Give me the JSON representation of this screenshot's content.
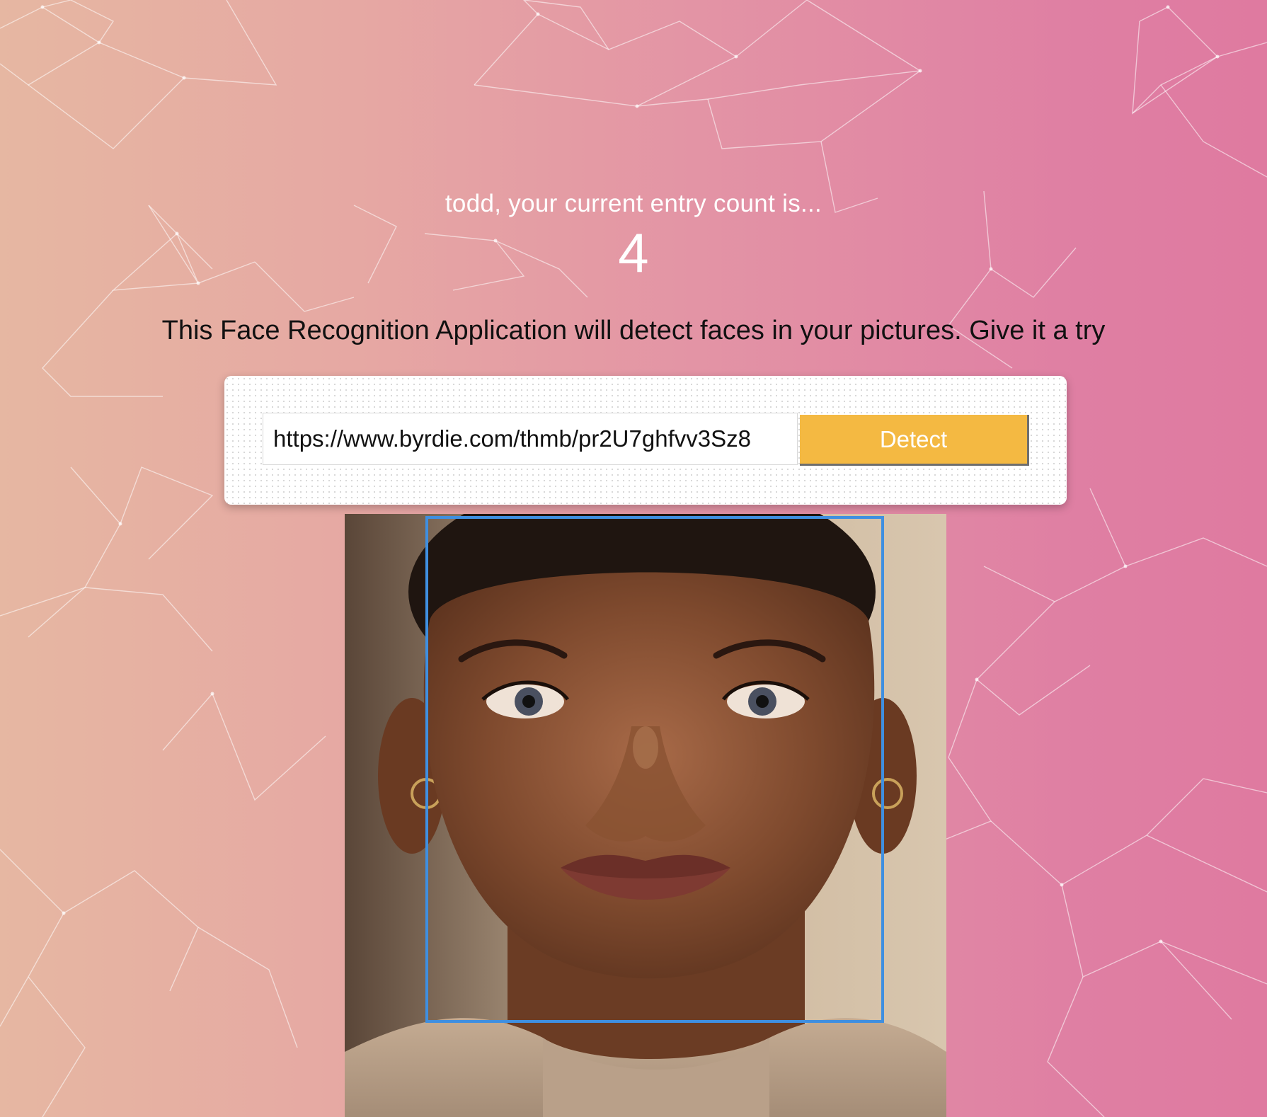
{
  "greeting": {
    "entry_text": "todd, your current entry count is...",
    "entry_count": "4"
  },
  "description": "This Face Recognition Application will detect faces in your pictures. Give it a try",
  "form": {
    "url_value": "https://www.byrdie.com/thmb/pr2U7ghfvv3Sz8",
    "button_label": "Detect"
  },
  "colors": {
    "button": "#f4b942",
    "face_box": "#3f8fe0",
    "gradient_left": "#e6b7a2",
    "gradient_right": "#df7aa0"
  }
}
